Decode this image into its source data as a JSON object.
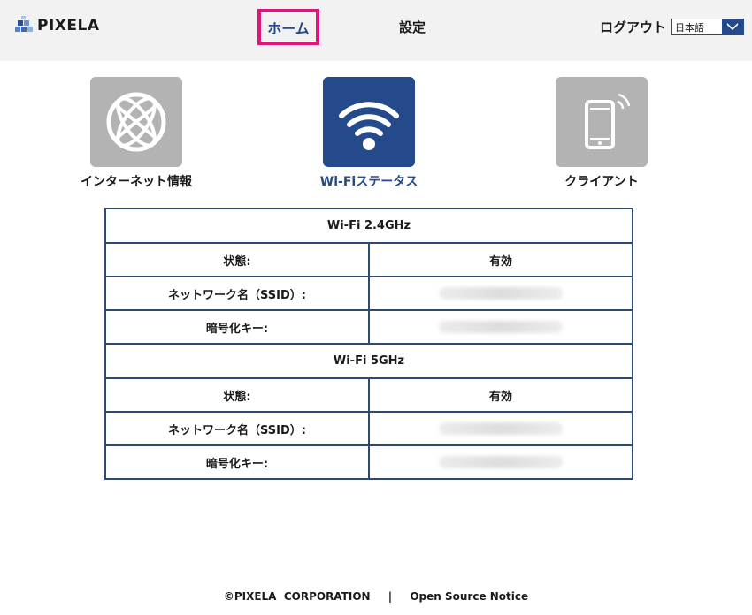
{
  "header": {
    "logo_text": "PIXELA",
    "nav_home": "ホーム",
    "nav_settings": "設定",
    "logout": "ログアウト",
    "language": "日本語"
  },
  "tiles": [
    {
      "label": "インターネット情報",
      "icon": "globe-icon",
      "active": false
    },
    {
      "label": "Wi-Fiステータス",
      "icon": "wifi-icon",
      "active": true
    },
    {
      "label": "クライアント",
      "icon": "smartphone-icon",
      "active": false
    }
  ],
  "wifi_24": {
    "title": "Wi-Fi 2.4GHz",
    "status_label": "状態:",
    "status_value": "有効",
    "ssid_label": "ネットワーク名（SSID）:",
    "key_label": "暗号化キー:"
  },
  "wifi_5": {
    "title": "Wi-Fi 5GHz",
    "status_label": "状態:",
    "status_value": "有効",
    "ssid_label": "ネットワーク名（SSID）:",
    "key_label": "暗号化キー:"
  },
  "footer": {
    "copyright": "©PIXELA  CORPORATION",
    "separator": "|",
    "oss_link": "Open Source Notice"
  },
  "colors": {
    "accent": "#244a8c",
    "highlight": "#e0157a",
    "tile_grey": "#b3b3b3"
  }
}
